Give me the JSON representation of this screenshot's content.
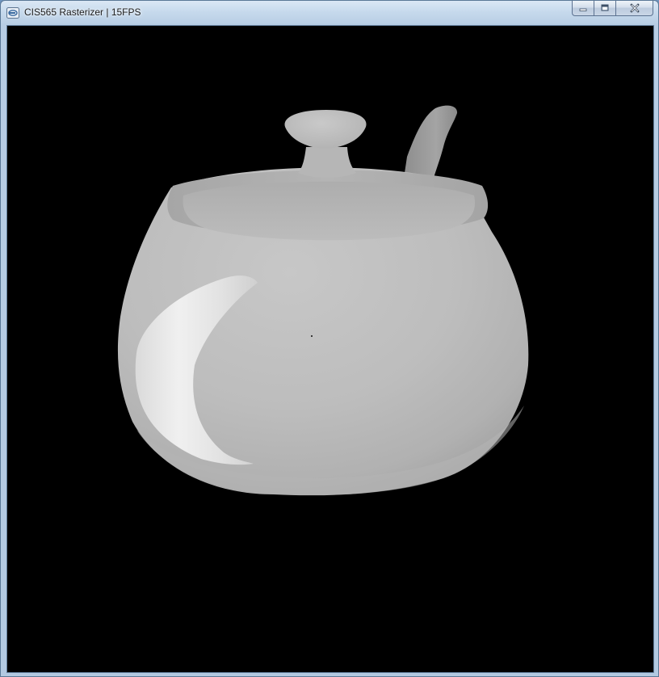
{
  "window": {
    "title": "CIS565 Rasterizer | 15FPS",
    "icon": "app-window-icon",
    "controls": {
      "minimize_icon": "minimize-icon",
      "maximize_icon": "maximize-icon",
      "close_icon": "close-icon"
    }
  },
  "viewport": {
    "background": "#000000",
    "model_color": "#c8c8c8",
    "scene": "teapot-render"
  }
}
